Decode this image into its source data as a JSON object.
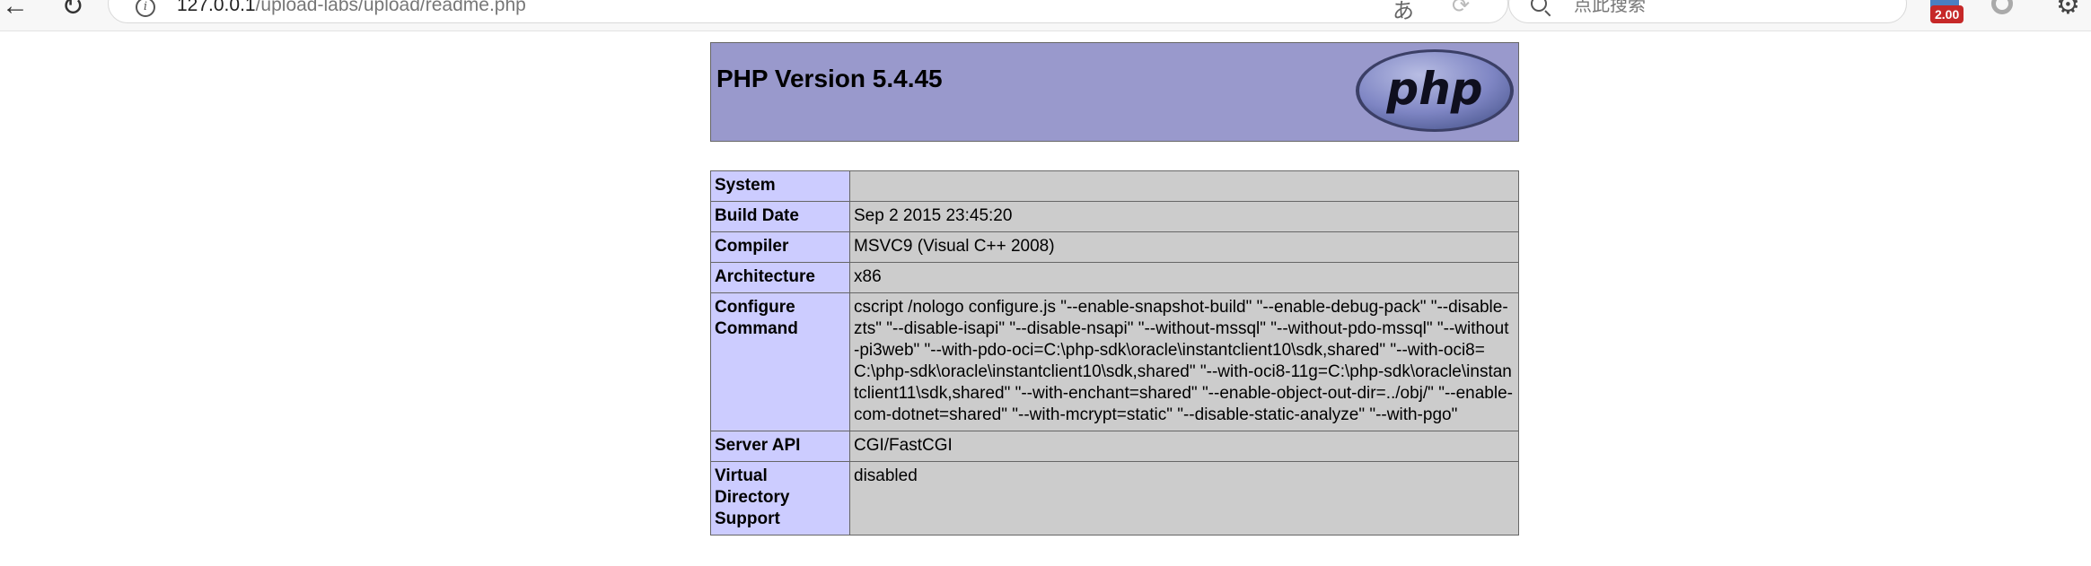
{
  "browser": {
    "url_host": "127.0.0.1",
    "url_path": "/upload-labs/upload/readme.php",
    "search_placeholder": "点此搜索",
    "extension_badge": "2.00",
    "address_icons": [
      "translate-icon",
      "refresh-extension-icon",
      "read-aloud-icon",
      "favorite-star-icon"
    ]
  },
  "page": {
    "title": "PHP Version 5.4.45",
    "logo_text": "php"
  },
  "rows": [
    {
      "key": "System",
      "value": ""
    },
    {
      "key": "Build Date",
      "value": "Sep 2 2015 23:45:20"
    },
    {
      "key": "Compiler",
      "value": "MSVC9 (Visual C++ 2008)"
    },
    {
      "key": "Architecture",
      "value": "x86"
    },
    {
      "key": "Configure Command",
      "value": "cscript /nologo configure.js \"--enable-snapshot-build\" \"--enable-debug-pack\" \"--disable-zts\" \"--disable-isapi\" \"--disable-nsapi\" \"--without-mssql\" \"--without-pdo-mssql\" \"--without-pi3web\" \"--with-pdo-oci=C:\\php-sdk\\oracle\\instantclient10\\sdk,shared\" \"--with-oci8=C:\\php-sdk\\oracle\\instantclient10\\sdk,shared\" \"--with-oci8-11g=C:\\php-sdk\\oracle\\instantclient11\\sdk,shared\" \"--with-enchant=shared\" \"--enable-object-out-dir=../obj/\" \"--enable-com-dotnet=shared\" \"--with-mcrypt=static\" \"--disable-static-analyze\" \"--with-pgo\""
    },
    {
      "key": "Server API",
      "value": "CGI/FastCGI"
    },
    {
      "key": "Virtual Directory Support",
      "value": "disabled"
    }
  ]
}
